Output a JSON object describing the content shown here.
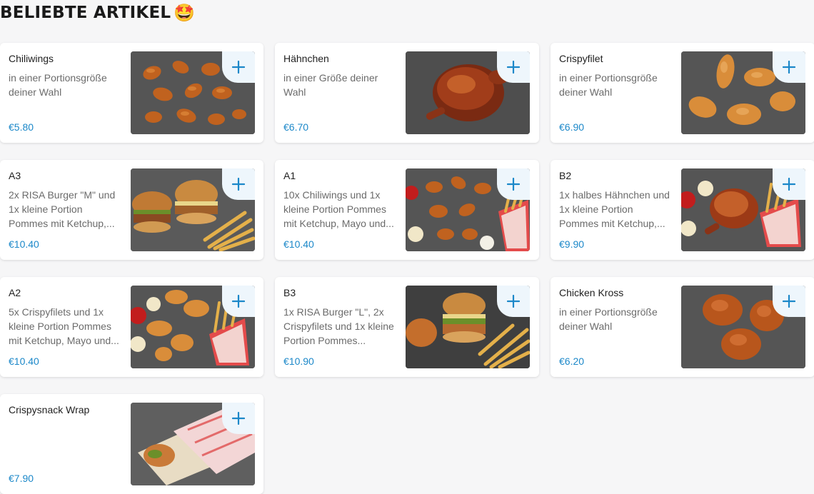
{
  "section": {
    "title": "BELIEBTE ARTIKEL",
    "emoji": "🤩"
  },
  "colors": {
    "price": "#1c88c9",
    "add_button_bg": "#eef6fc",
    "add_icon": "#1c88c9"
  },
  "items": [
    {
      "name": "Chiliwings",
      "description": "in einer Portionsgröße deiner Wahl",
      "price": "€5.80",
      "image_icon": "chicken-wings-photo"
    },
    {
      "name": "Hähnchen",
      "description": "in einer Größe deiner Wahl",
      "price": "€6.70",
      "image_icon": "grilled-chicken-photo"
    },
    {
      "name": "Crispyfilet",
      "description": "in einer Portionsgröße deiner Wahl",
      "price": "€6.90",
      "image_icon": "crispy-filet-photo"
    },
    {
      "name": "A3",
      "description": "2x RISA Burger \"M\" und 1x kleine Portion Pommes mit Ketchup,...",
      "price": "€10.40",
      "image_icon": "burger-fries-photo"
    },
    {
      "name": "A1",
      "description": "10x Chiliwings und 1x kleine Portion Pommes mit Ketchup, Mayo und...",
      "price": "€10.40",
      "image_icon": "wings-fries-photo"
    },
    {
      "name": "B2",
      "description": "1x halbes Hähnchen und 1x kleine Portion Pommes mit Ketchup,...",
      "price": "€9.90",
      "image_icon": "half-chicken-fries-photo"
    },
    {
      "name": "A2",
      "description": "5x Crispyfilets und 1x kleine Portion Pommes mit Ketchup, Mayo und...",
      "price": "€10.40",
      "image_icon": "filets-fries-photo"
    },
    {
      "name": "B3",
      "description": "1x RISA Burger \"L\", 2x Crispyfilets und 1x kleine Portion Pommes...",
      "price": "€10.90",
      "image_icon": "burger-filet-fries-photo"
    },
    {
      "name": "Chicken Kross",
      "description": "in einer Portionsgröße deiner Wahl",
      "price": "€6.20",
      "image_icon": "chicken-kross-photo"
    },
    {
      "name": "Crispysnack Wrap",
      "description": "",
      "price": "€7.90",
      "image_icon": "wrap-photo"
    }
  ]
}
